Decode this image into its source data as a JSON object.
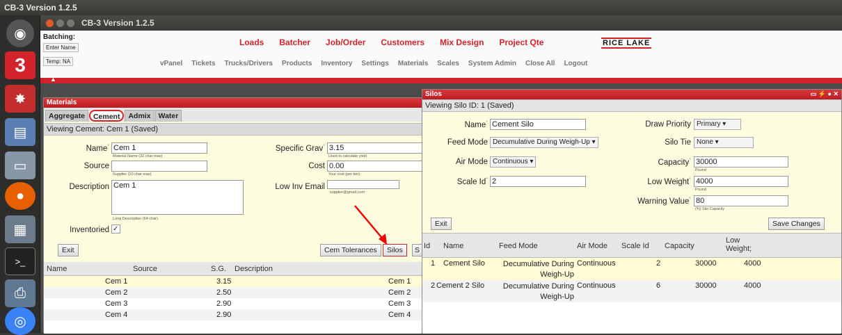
{
  "os": {
    "title": "CB-3 Version 1.2.5"
  },
  "launcher": {
    "icons": [
      "dash-icon",
      "cb3-app-icon",
      "splat-icon",
      "files-icon",
      "disk-icon",
      "firefox-icon",
      "calculator-icon",
      "terminal-icon",
      "printer-icon",
      "chrome-icon"
    ]
  },
  "app": {
    "title": "CB-3 Version 1.2.5",
    "batching_label": "Batching:",
    "enter_name": "Enter Name",
    "temp": "Temp: NA",
    "nav_primary": [
      "Loads",
      "Batcher",
      "Job/Order",
      "Customers",
      "Mix Design",
      "Project Qte"
    ],
    "logo": "RICE LAKE",
    "nav_secondary": [
      "vPanel",
      "Tickets",
      "Trucks/Drivers",
      "Products",
      "Inventory",
      "Settings",
      "Materials",
      "Scales",
      "System Admin",
      "Close All",
      "Logout"
    ]
  },
  "materials": {
    "title": "Materials",
    "tabs": [
      "Aggregate",
      "Cement",
      "Admix",
      "Water"
    ],
    "viewing": "Viewing Cement: Cem 1 (Saved)",
    "name_label": "Name",
    "name_value": "Cem 1",
    "name_hint": "Material Name (32 char max)",
    "source_label": "Source",
    "source_value": "",
    "source_hint": "Supplier (10 char max)",
    "desc_label": "Description",
    "desc_value": "Cem 1",
    "desc_hint": "Long Description (64 char)",
    "inventoried_label": "Inventoried",
    "inventoried_check": "✓",
    "sg_label": "Specific Grav",
    "sg_value": "3.15",
    "sg_hint": "Used to calculate yield",
    "cost_label": "Cost",
    "cost_value": "0.00",
    "cost_hint": "Your cost (per ton)",
    "lowinv_label": "Low Inv Email",
    "lowinv_hint": "supplier@gmail.com",
    "exit": "Exit",
    "cem_tol": "Cem Tolerances",
    "silos": "Silos",
    "s_cut": "S",
    "columns": [
      "Name",
      "Source",
      "S.G.",
      "Description"
    ],
    "rows": [
      {
        "name": "Cem 1",
        "source": "",
        "sg": "3.15",
        "desc": "Cem 1"
      },
      {
        "name": "Cem 2",
        "source": "",
        "sg": "2.50",
        "desc": "Cem 2"
      },
      {
        "name": "Cem 3",
        "source": "",
        "sg": "2.90",
        "desc": "Cem 3"
      },
      {
        "name": "Cem 4",
        "source": "",
        "sg": "2.90",
        "desc": "Cem 4"
      }
    ]
  },
  "silos": {
    "title": "Silos",
    "viewing": "Viewing Silo ID: 1 (Saved)",
    "name_label": "Name",
    "name_value": "Cement Silo",
    "feed_label": "Feed Mode",
    "feed_value": "Decumulative During Weigh-Up",
    "air_label": "Air Mode",
    "air_value": "Continuous",
    "scale_label": "Scale Id",
    "scale_value": "2",
    "draw_label": "Draw Priority",
    "draw_value": "Primary",
    "tie_label": "Silo Tie",
    "tie_value": "None",
    "cap_label": "Capacity",
    "cap_value": "30000",
    "cap_hint": "Pound",
    "low_label": "Low Weight",
    "low_value": "4000",
    "low_hint": "Pound",
    "warn_label": "Warning Value",
    "warn_value": "80",
    "warn_hint": "(%) Silo Capacity",
    "exit": "Exit",
    "save": "Save Changes",
    "columns": [
      "Id",
      "Name",
      "Feed Mode",
      "Air Mode",
      "Scale Id",
      "Capacity",
      "Low Weight;"
    ],
    "rows": [
      {
        "id": "1",
        "name": "Cement Silo",
        "feed": "Decumulative During Weigh-Up",
        "air": "Continuous",
        "scale": "2",
        "cap": "30000",
        "low": "4000"
      },
      {
        "id": "2",
        "name": "Cement 2 Silo",
        "feed": "Decumulative During Weigh-Up",
        "air": "Continuous",
        "scale": "6",
        "cap": "30000",
        "low": "4000"
      }
    ]
  },
  "colors": {
    "accent_red": "#d2232a",
    "panel_yellow": "#fffde0"
  }
}
